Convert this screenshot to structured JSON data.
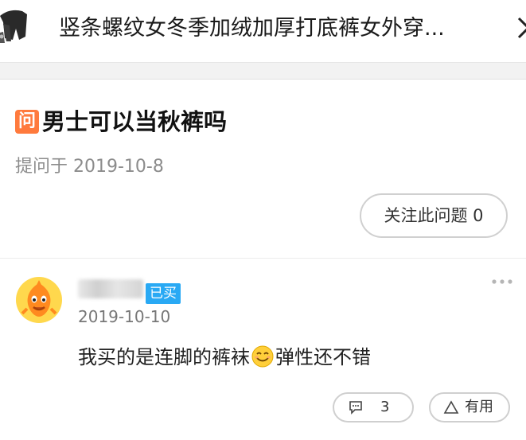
{
  "header": {
    "title": "竖条螺纹女冬季加绒加厚打底裤女外穿...",
    "product_thumb_icon": "product-thumbnail",
    "close_icon": "close-icon"
  },
  "question": {
    "badge": "问",
    "title": "男士可以当秋裤吗",
    "asked_date": "提问于 2019-10-8",
    "follow_label": "关注此问题 0"
  },
  "answer": {
    "bought_badge": "已买",
    "date": "2019-10-10",
    "text_before_emoji": "我买的是连脚的裤袜",
    "text_after_emoji": "弹性还不错",
    "emoji": "smile-emoji",
    "comment_count": "3",
    "useful_label": "有用"
  },
  "colors": {
    "question_badge": "#ff7a3d",
    "bought_badge": "#29a9f4",
    "avatar_orange": "#ff8a1f"
  }
}
